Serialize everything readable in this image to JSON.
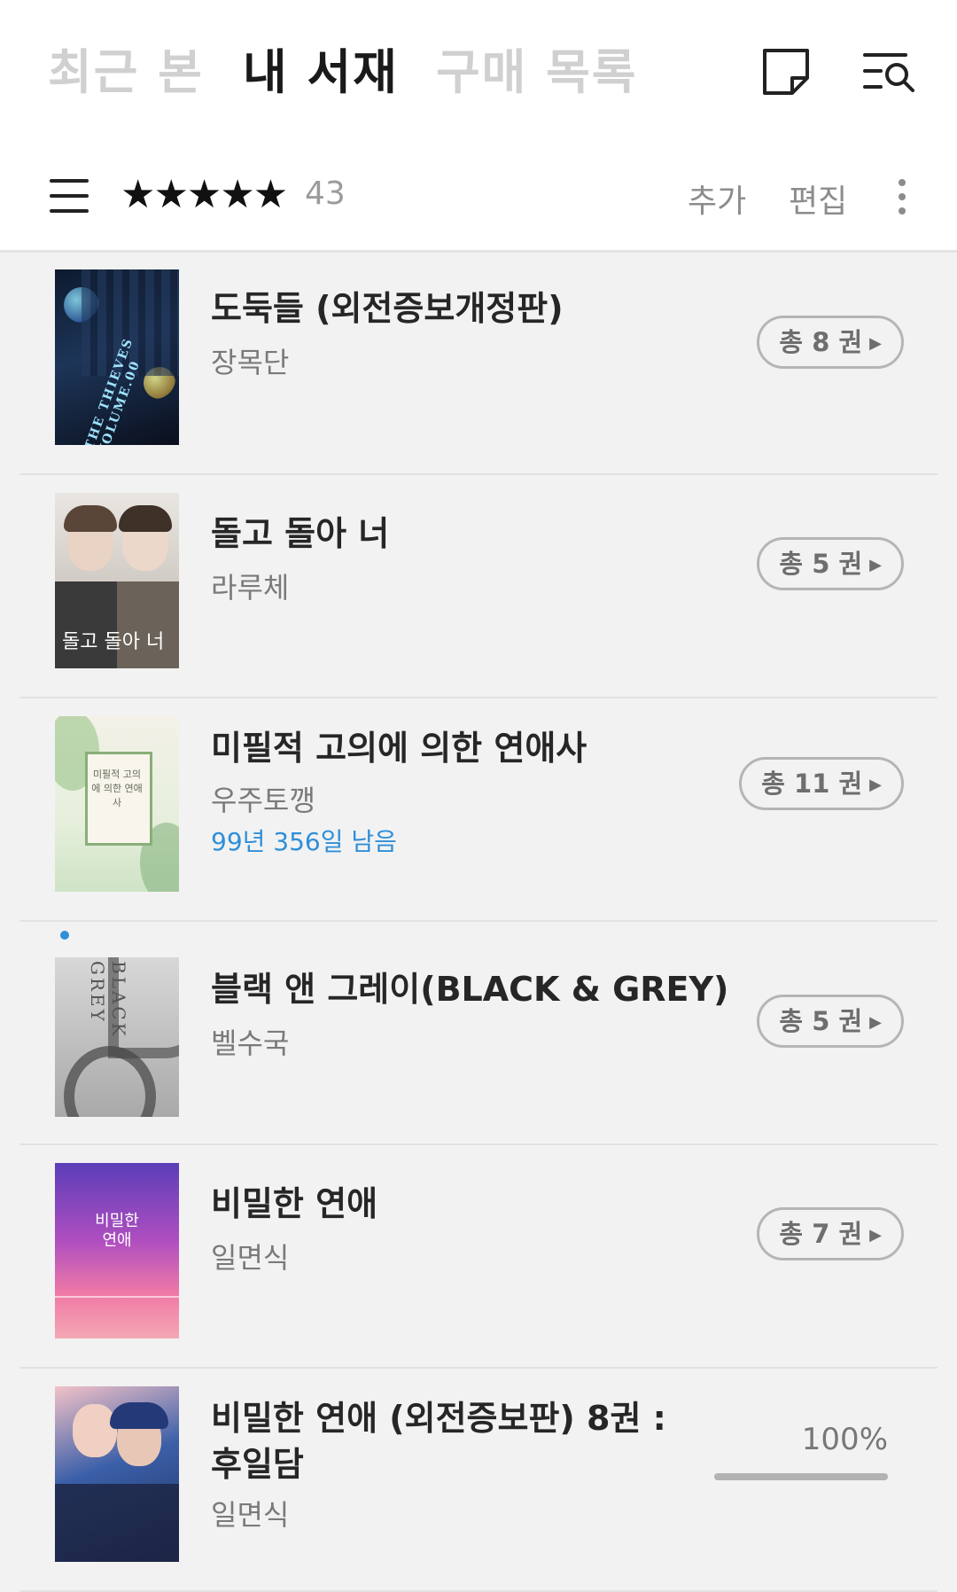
{
  "tabs": {
    "recent": "최근 본",
    "shelf": "내 서재",
    "purchase": "구매 목록"
  },
  "toolbar": {
    "stars": "★★★★★",
    "rating_count": "43",
    "add_label": "추가",
    "edit_label": "편집"
  },
  "books": [
    {
      "title": "도둑들 (외전증보개정판)",
      "author": "장목단",
      "volumes": "총 8 권",
      "cover_text": "THE THIEVES VOLUME.00"
    },
    {
      "title": "돌고 돌아 너",
      "author": "라루체",
      "volumes": "총 5 권",
      "cover_text": "돌고 돌아 너"
    },
    {
      "title": "미필적 고의에 의한 연애사",
      "author": "우주토깽",
      "remaining": "99년 356일 남음",
      "volumes": "총 11 권",
      "cover_text": "미필적 고의에 의한 연애사"
    },
    {
      "title": "블랙 앤 그레이(BLACK & GREY)",
      "author": "벨수국",
      "volumes": "총 5 권",
      "cover_text": "BLACK GREY"
    },
    {
      "title": "비밀한 연애",
      "author": "일면식",
      "volumes": "총 7 권",
      "cover_text": "비밀한 연애"
    },
    {
      "title_line1": "비밀한 연애 (외전증보판) 8권 :",
      "title_line2": "후일담",
      "author": "일면식",
      "progress_label": "100%",
      "progress": 1.0
    }
  ],
  "colors": {
    "accent_blue": "#2f8fd8",
    "inactive_tab": "#d0d0d0",
    "active_tab": "#1a1a1a"
  }
}
